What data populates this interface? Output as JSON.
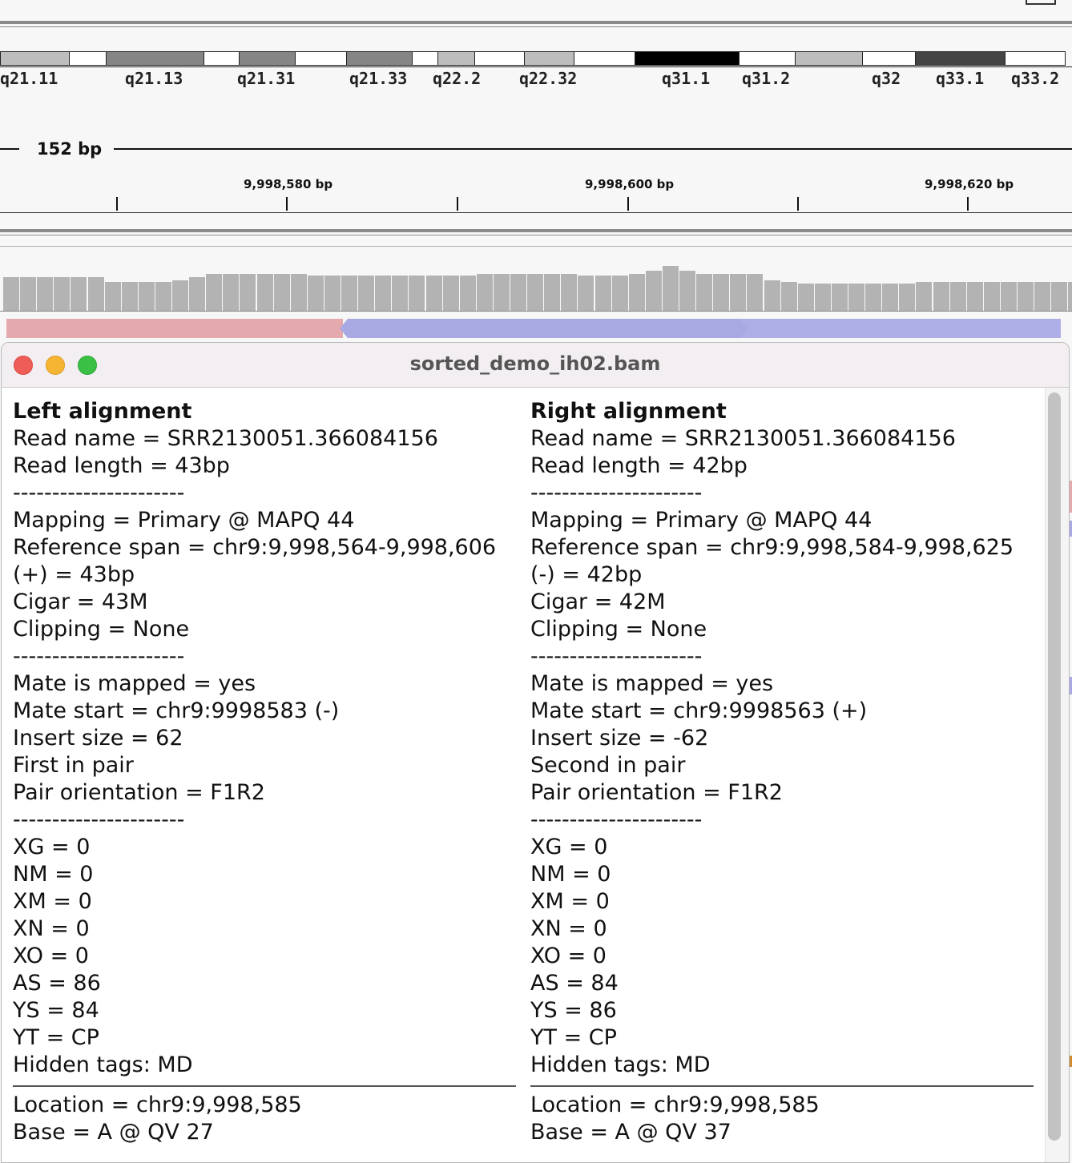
{
  "window": {
    "title": "sorted_demo_ih02.bam",
    "controls": [
      "close",
      "minimize",
      "zoom"
    ]
  },
  "ideogram": {
    "band_labels": [
      "q21.11",
      "q21.13",
      "q21.31",
      "q21.33",
      "q22.2",
      "q22.32",
      "q31.1",
      "q31.2",
      "q32",
      "q33.1",
      "q33.2"
    ]
  },
  "ruler": {
    "span": "152 bp",
    "ticks": [
      "9,998,580 bp",
      "9,998,600 bp",
      "9,998,620 bp"
    ]
  },
  "popup": {
    "left": {
      "heading": "Left alignment",
      "read_info": [
        "Read name = SRR2130051.366084156",
        "Read length = 43bp"
      ],
      "sep1": "----------------------",
      "mapping_info": [
        "Mapping = Primary @ MAPQ 44",
        "Reference span = chr9:9,998,564-9,998,606",
        "(+) = 43bp",
        "Cigar = 43M",
        "Clipping = None"
      ],
      "sep2": "----------------------",
      "mate_info": [
        "Mate is mapped = yes",
        "Mate start = chr9:9998583 (-)",
        "Insert size = 62",
        "First in pair",
        "Pair orientation = F1R2"
      ],
      "sep3": "----------------------",
      "tags": [
        "XG = 0",
        "NM = 0",
        "XM = 0",
        "XN = 0",
        "XO = 0",
        "AS = 86",
        "YS = 84",
        "YT = CP",
        "Hidden tags: MD"
      ],
      "location": [
        "Location = chr9:9,998,585",
        "Base = A @ QV 27"
      ]
    },
    "right": {
      "heading": "Right alignment",
      "read_info": [
        "Read name = SRR2130051.366084156",
        "Read length = 42bp"
      ],
      "sep1": "----------------------",
      "mapping_info": [
        "Mapping = Primary @ MAPQ 44",
        "Reference span = chr9:9,998,584-9,998,625",
        "(-) = 42bp",
        "Cigar = 42M",
        "Clipping = None"
      ],
      "sep2": "----------------------",
      "mate_info": [
        "Mate is mapped = yes",
        "Mate start = chr9:9998563 (+)",
        "Insert size = -62",
        "Second in pair",
        "Pair orientation = F1R2"
      ],
      "sep3": "----------------------",
      "tags": [
        "XG = 0",
        "NM = 0",
        "XM = 0",
        "XN = 0",
        "XO = 0",
        "AS = 84",
        "YS = 86",
        "YT = CP",
        "Hidden tags: MD"
      ],
      "location": [
        "Location = chr9:9,998,585",
        "Base = A @ QV 37"
      ]
    }
  },
  "colors": {
    "forward_read": "#e3a9ad",
    "reverse_read": "#a8a8e3",
    "coverage": "#b3b3b3"
  }
}
